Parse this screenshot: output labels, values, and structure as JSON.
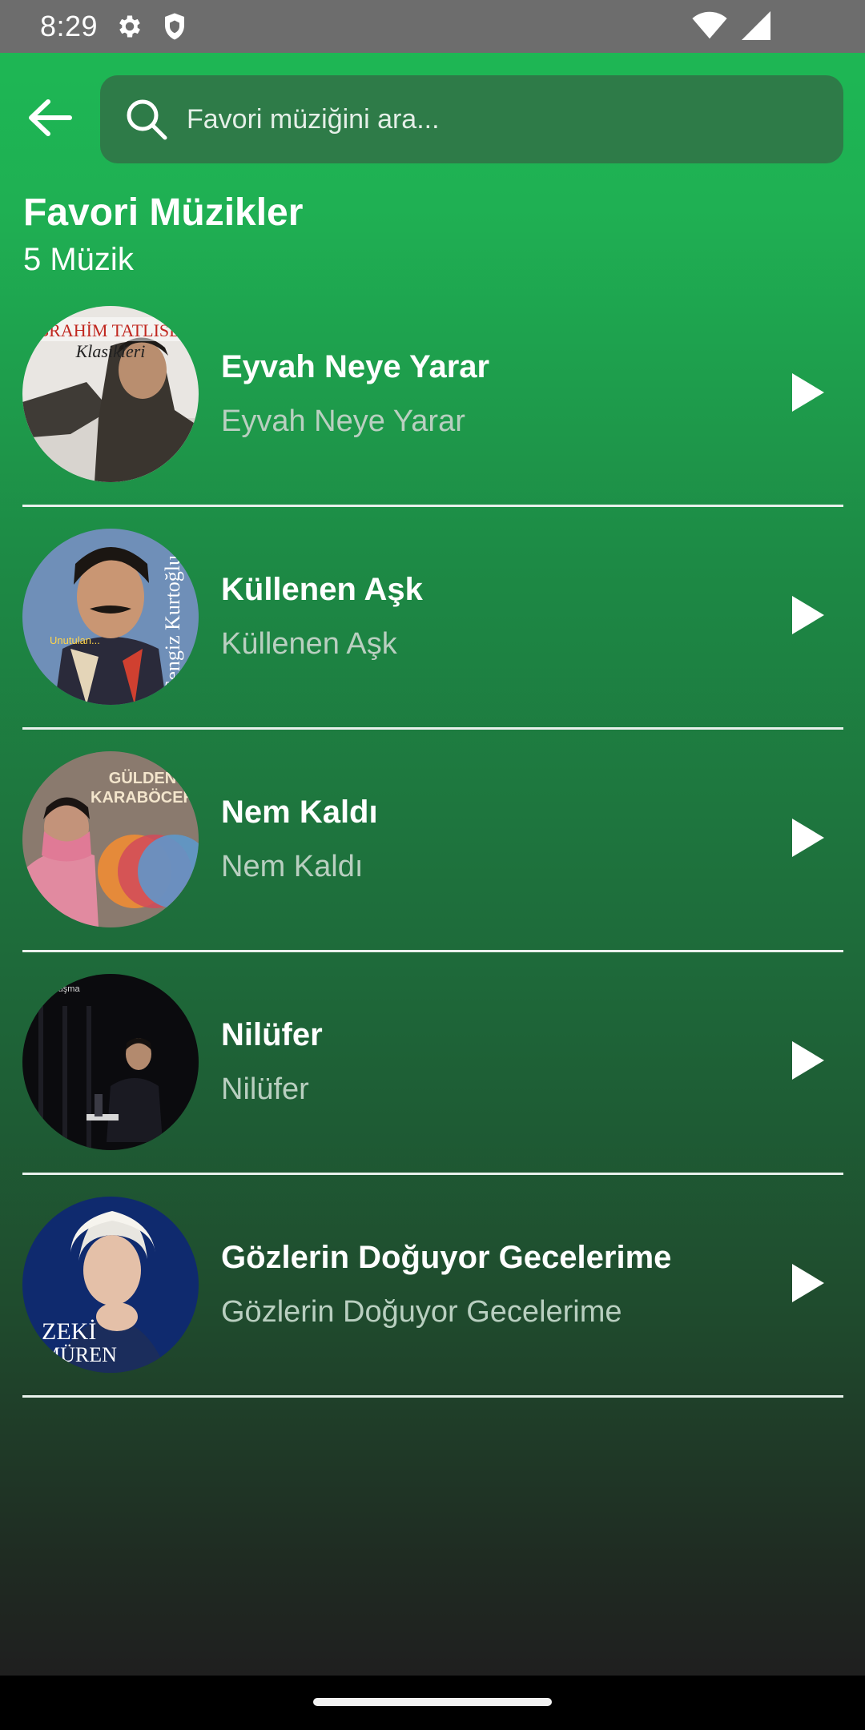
{
  "status_bar": {
    "time": "8:29",
    "icons": [
      "gear-icon",
      "shield-icon",
      "wifi-icon",
      "signal-icon"
    ]
  },
  "search": {
    "placeholder": "Favori müziğini ara...",
    "value": ""
  },
  "header": {
    "title": "Favori Müzikler",
    "count": "5 Müzik"
  },
  "songs": [
    {
      "title": "Eyvah Neye Yarar",
      "artist": "Eyvah Neye Yarar",
      "cover_text": [
        "İBRAHİM TATLISES",
        "Klasikleri"
      ]
    },
    {
      "title": "Küllenen Aşk",
      "artist": "Küllenen Aşk",
      "cover_text": [
        "Cengiz Kurtoğlu",
        "Unutulan..."
      ]
    },
    {
      "title": "Nem Kaldı",
      "artist": "Nem Kaldı",
      "cover_text": [
        "GÜLDEN",
        "KARABÖCEK"
      ]
    },
    {
      "title": "Nilüfer",
      "artist": "Nilüfer",
      "cover_text": [
        "buluşma"
      ]
    },
    {
      "title": "Gözlerin Doğuyor Gecelerime",
      "artist": "Gözlerin Doğuyor Gecelerime",
      "cover_text": [
        "ZEKİ",
        "MÜREN"
      ]
    }
  ],
  "colors": {
    "accent": "#1db954",
    "search_bg": "#2e7b48",
    "artist_text": "#b9cfc0",
    "background_bottom": "#1f1f1f"
  }
}
